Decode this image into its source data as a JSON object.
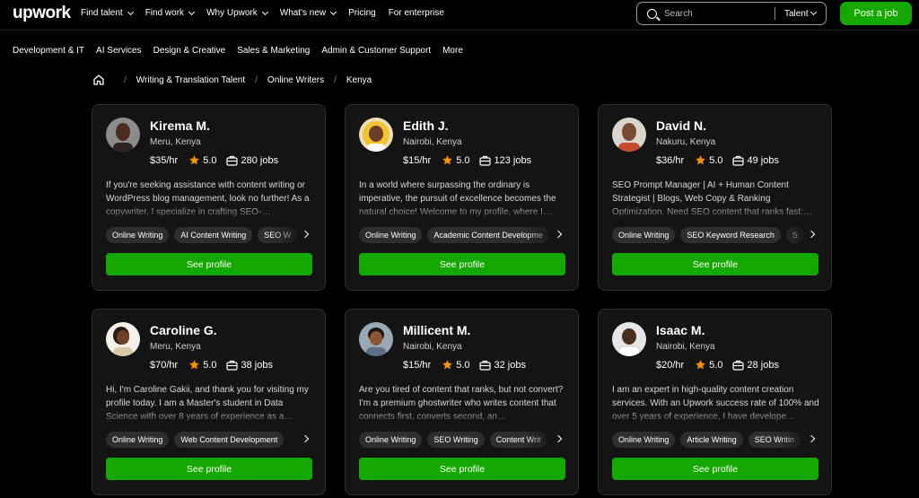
{
  "header": {
    "logo": "upwork",
    "nav": [
      {
        "label": "Find talent",
        "has_dropdown": true
      },
      {
        "label": "Find work",
        "has_dropdown": true
      },
      {
        "label": "Why Upwork",
        "has_dropdown": true
      },
      {
        "label": "What's new",
        "has_dropdown": true
      },
      {
        "label": "Pricing",
        "has_dropdown": false
      },
      {
        "label": "For enterprise",
        "has_dropdown": false
      }
    ],
    "search_placeholder": "Search",
    "search_scope": "Talent",
    "post_job_label": "Post a job"
  },
  "categories": [
    "Development & IT",
    "AI Services",
    "Design & Creative",
    "Sales & Marketing",
    "Admin & Customer Support",
    "More"
  ],
  "breadcrumb": [
    "Writing & Translation Talent",
    "Online Writers",
    "Kenya"
  ],
  "see_profile_label": "See profile",
  "colors": {
    "accent": "#14a800",
    "star": "#f39200",
    "card_bg": "#141414",
    "chip_bg": "#2e2e2e"
  },
  "freelancers": [
    {
      "name": "Kirema M.",
      "location": "Meru, Kenya",
      "rate": "$35/hr",
      "rating": "5.0",
      "jobs": "280 jobs",
      "bio": "If you're seeking assistance with content writing or WordPress blog management, look no further! As a copywriter, I specialize in crafting SEO-…",
      "skills": [
        "Online Writing",
        "AI Content Writing",
        "SEO W"
      ]
    },
    {
      "name": "Edith J.",
      "location": "Nairobi, Kenya",
      "rate": "$15/hr",
      "rating": "5.0",
      "jobs": "123 jobs",
      "bio": "In a world where surpassing the ordinary is imperative, the pursuit of excellence becomes the natural choice! Welcome to my profile, where I…",
      "skills": [
        "Online Writing",
        "Academic Content Developme"
      ]
    },
    {
      "name": "David N.",
      "location": "Nakuru, Kenya",
      "rate": "$36/hr",
      "rating": "5.0",
      "jobs": "49 jobs",
      "bio": "SEO Prompt Manager | AI + Human Content Strategist | Blogs, Web Copy & Ranking Optimization. Need SEO content that ranks fast:…",
      "skills": [
        "Online Writing",
        "SEO Keyword Research",
        "S"
      ]
    },
    {
      "name": "Caroline G.",
      "location": "Meru, Kenya",
      "rate": "$70/hr",
      "rating": "5.0",
      "jobs": "38 jobs",
      "bio": "Hi, I'm Caroline Gakii, and thank you for visiting my profile today. I am a Master's student in Data Science with over 8 years of experience as a…",
      "skills": [
        "Online Writing",
        "Web Content Development"
      ]
    },
    {
      "name": "Millicent M.",
      "location": "Nairobi, Kenya",
      "rate": "$15/hr",
      "rating": "5.0",
      "jobs": "32 jobs",
      "bio": "Are you tired of content that ranks, but not convert? I'm a premium ghostwriter who writes content that connects first, converts second, an…",
      "skills": [
        "Online Writing",
        "SEO Writing",
        "Content Writ"
      ]
    },
    {
      "name": "Isaac M.",
      "location": "Nairobi, Kenya",
      "rate": "$20/hr",
      "rating": "5.0",
      "jobs": "28 jobs",
      "bio": "I am an expert in high-quality content creation services. With an Upwork success rate of 100% and over 5 years of experience, I have develope…",
      "skills": [
        "Online Writing",
        "Article Writing",
        "SEO Writin"
      ]
    }
  ]
}
